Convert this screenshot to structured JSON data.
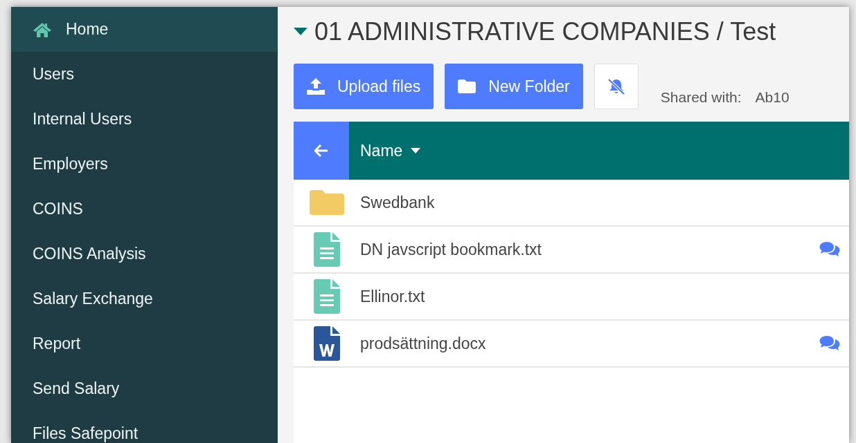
{
  "sidebar": {
    "items": [
      {
        "label": "Home",
        "selected": true,
        "kind": "home"
      },
      {
        "label": "Users",
        "selected": false
      },
      {
        "label": "Internal Users",
        "selected": false
      },
      {
        "label": "Employers",
        "selected": false
      },
      {
        "label": "COINS",
        "selected": false
      },
      {
        "label": "COINS Analysis",
        "selected": false
      },
      {
        "label": "Salary Exchange",
        "selected": false
      },
      {
        "label": "Report",
        "selected": false
      },
      {
        "label": "Send Salary",
        "selected": false
      },
      {
        "label": "Files Safepoint",
        "selected": false
      }
    ]
  },
  "title": "01 ADMINISTRATIVE COMPANIES / Test",
  "toolbar": {
    "buttons": [
      {
        "kind": "upload",
        "label": "Upload files"
      },
      {
        "kind": "folder",
        "label": "New Folder"
      },
      {
        "kind": "bell-off"
      }
    ],
    "shared_label": "Shared with:",
    "shared_value": "Ab10"
  },
  "table": {
    "columns": [
      {
        "label": "Name"
      }
    ],
    "rows": [
      {
        "kind": "folder",
        "name": "Swedbank",
        "comments": false
      },
      {
        "kind": "text",
        "name": "DN javscript bookmark.txt",
        "comments": true
      },
      {
        "kind": "text",
        "name": "Ellinor.txt",
        "comments": false
      },
      {
        "kind": "word",
        "name": "prodsättning.docx",
        "comments": true
      }
    ]
  }
}
